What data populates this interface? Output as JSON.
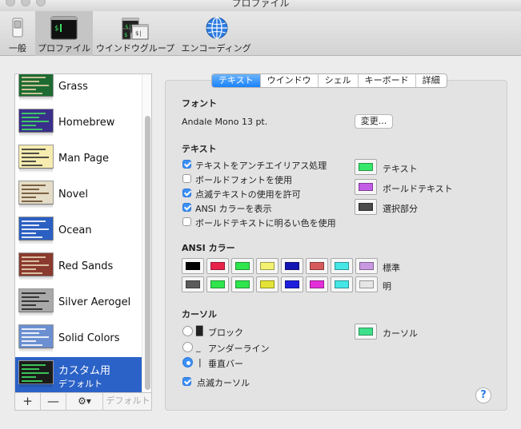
{
  "window": {
    "title": "プロファイル"
  },
  "toolbar": {
    "items": [
      {
        "label": "一般",
        "icon": "switch-icon"
      },
      {
        "label": "プロファイル",
        "icon": "terminal-icon",
        "active": true
      },
      {
        "label": "ウインドウグループ",
        "icon": "window-group-icon"
      },
      {
        "label": "エンコーディング",
        "icon": "globe-icon"
      }
    ]
  },
  "profiles": [
    {
      "name": "Grass",
      "thumb_bg": "#1d6b32",
      "thumb_fg": "#e6d0a6"
    },
    {
      "name": "Homebrew",
      "thumb_bg": "#3a2f8a",
      "thumb_fg": "#3fe060"
    },
    {
      "name": "Man Page",
      "thumb_bg": "#f6ecb0",
      "thumb_fg": "#333333"
    },
    {
      "name": "Novel",
      "thumb_bg": "#e4dcc6",
      "thumb_fg": "#6a4a2a"
    },
    {
      "name": "Ocean",
      "thumb_bg": "#2b5fc2",
      "thumb_fg": "#ffffff"
    },
    {
      "name": "Red Sands",
      "thumb_bg": "#8a3a2e",
      "thumb_fg": "#e9d7b4"
    },
    {
      "name": "Silver Aerogel",
      "thumb_bg": "#a9a9a9",
      "thumb_fg": "#222222"
    },
    {
      "name": "Solid Colors",
      "thumb_bg": "#6b8fd1",
      "thumb_fg": "#ffffff"
    },
    {
      "name": "カスタム用",
      "sub": "デフォルト",
      "thumb_bg": "#1b1b1b",
      "thumb_fg": "#3fe060",
      "selected": true
    }
  ],
  "sidebar_footer": {
    "add": "+",
    "remove": "—",
    "gear": "⚙▾",
    "default": "デフォルト"
  },
  "tabs": [
    {
      "label": "テキスト",
      "active": true
    },
    {
      "label": "ウインドウ"
    },
    {
      "label": "シェル"
    },
    {
      "label": "キーボード"
    },
    {
      "label": "詳細"
    }
  ],
  "font": {
    "section": "フォント",
    "value": "Andale Mono 13 pt.",
    "change_button": "変更..."
  },
  "text": {
    "section": "テキスト",
    "options": [
      {
        "label": "テキストをアンチエイリアス処理",
        "checked": true
      },
      {
        "label": "ボールドフォントを使用",
        "checked": false
      },
      {
        "label": "点滅テキストの使用を許可",
        "checked": true
      },
      {
        "label": "ANSI カラーを表示",
        "checked": true
      },
      {
        "label": "ボールドテキストに明るい色を使用",
        "checked": false
      }
    ],
    "colors": [
      {
        "label": "テキスト",
        "color": "#36e86a"
      },
      {
        "label": "ボールドテキスト",
        "color": "#c35de6"
      },
      {
        "label": "選択部分",
        "color": "#4a4a4a"
      }
    ]
  },
  "ansi": {
    "section": "ANSI カラー",
    "normal_label": "標準",
    "bright_label": "明",
    "normal": [
      "#000000",
      "#e8234b",
      "#2ee54e",
      "#f2f270",
      "#1414b4",
      "#d65a5a",
      "#45e6e6",
      "#c899e0"
    ],
    "bright": [
      "#5c5c5c",
      "#2ee54e",
      "#2ee54e",
      "#e3e337",
      "#1e1edc",
      "#e42ed9",
      "#45e6e6",
      "#e6e6e6"
    ]
  },
  "cursor": {
    "section": "カーソル",
    "options": [
      {
        "glyph": "█",
        "label": "ブロック",
        "selected": false
      },
      {
        "glyph": "_",
        "label": "アンダーライン",
        "selected": false
      },
      {
        "glyph": "|",
        "label": "垂直バー",
        "selected": true
      }
    ],
    "color_label": "カーソル",
    "color": "#3ee08a",
    "blink_label": "点滅カーソル",
    "blink": true
  },
  "help": {
    "label": "?"
  }
}
